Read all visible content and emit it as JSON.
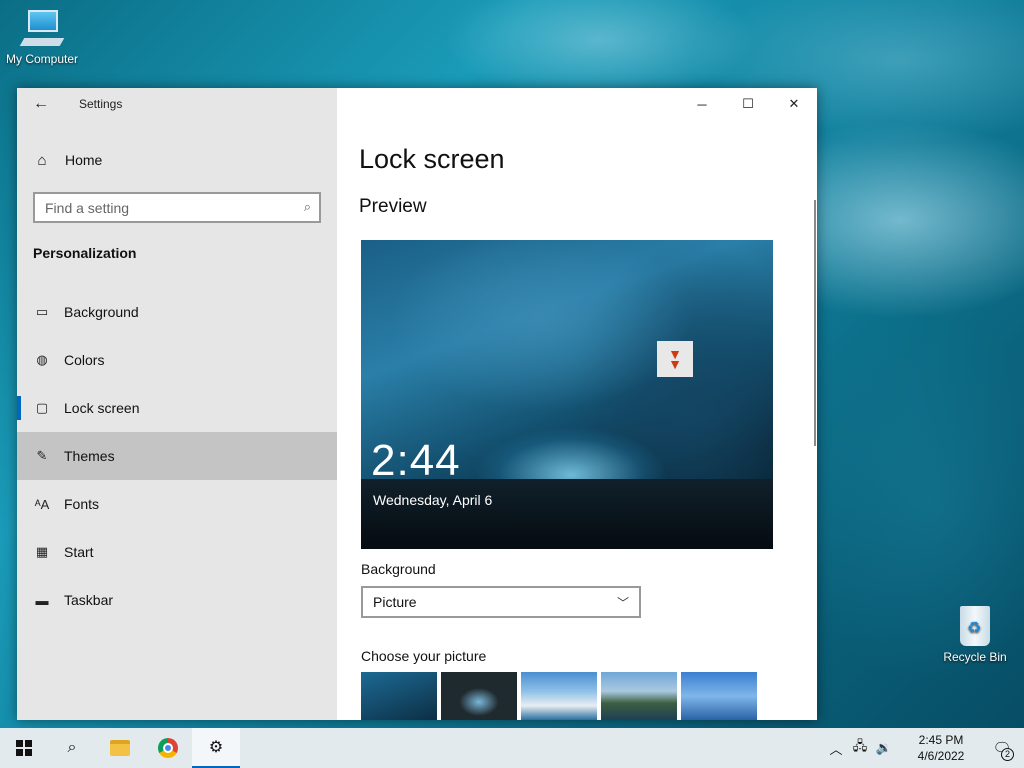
{
  "desktop": {
    "icons": [
      {
        "label": "My Computer"
      },
      {
        "label": "Recycle Bin"
      }
    ]
  },
  "window": {
    "app_title": "Settings",
    "caption": {
      "minimize": "─",
      "maximize": "☐",
      "close": "✕"
    }
  },
  "nav": {
    "home_label": "Home",
    "search_placeholder": "Find a setting",
    "section_title": "Personalization",
    "items": [
      {
        "label": "Background",
        "icon": "image-icon",
        "state": "normal"
      },
      {
        "label": "Colors",
        "icon": "palette-icon",
        "state": "normal"
      },
      {
        "label": "Lock screen",
        "icon": "lock-screen-icon",
        "state": "selected"
      },
      {
        "label": "Themes",
        "icon": "brush-icon",
        "state": "hover"
      },
      {
        "label": "Fonts",
        "icon": "font-icon",
        "state": "normal"
      },
      {
        "label": "Start",
        "icon": "start-icon",
        "state": "normal"
      },
      {
        "label": "Taskbar",
        "icon": "taskbar-icon",
        "state": "normal"
      }
    ]
  },
  "content": {
    "page_title": "Lock screen",
    "preview_title": "Preview",
    "preview_time": "2:44",
    "preview_date": "Wednesday, April 6",
    "background_label": "Background",
    "background_value": "Picture",
    "choose_label": "Choose your picture"
  },
  "taskbar": {
    "clock_time": "2:45 PM",
    "clock_date": "4/6/2022",
    "notification_count": "2"
  },
  "colors": {
    "accent": "#0067c0",
    "nav_bg": "#e6e6e6",
    "taskbar_bg": "#e2eaee"
  }
}
